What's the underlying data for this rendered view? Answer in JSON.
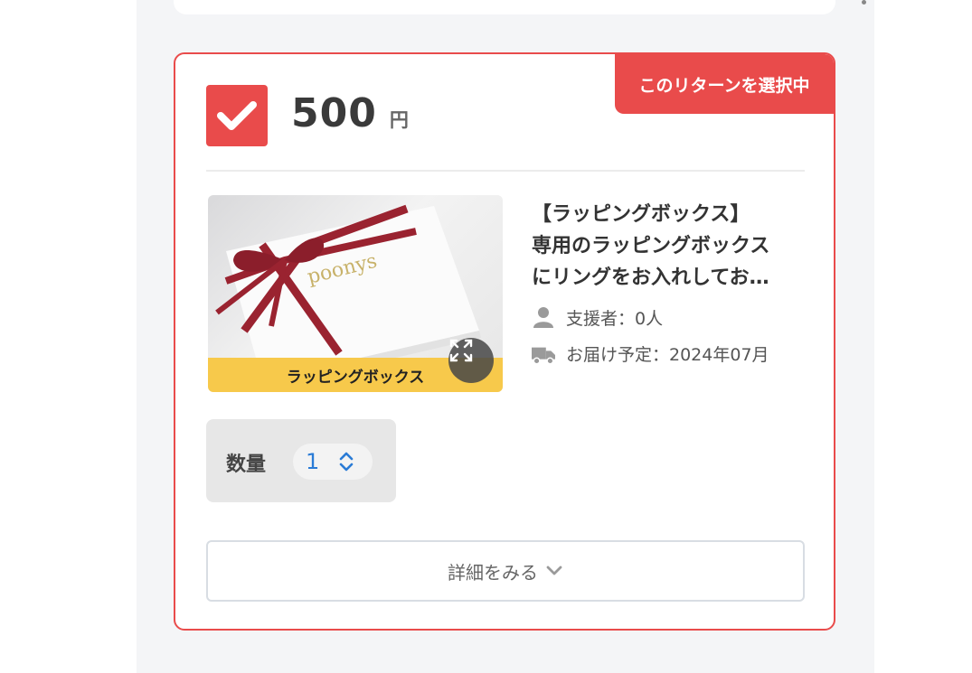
{
  "reward": {
    "selected_badge": "このリターンを選択中",
    "price": "500",
    "currency": "円",
    "image_label": "ラッピングボックス",
    "image_brand_text": "poonys",
    "title_lines": [
      "【ラッピングボックス】",
      "専用のラッピングボックス",
      "にリングをお入れしてお…"
    ],
    "supporters": "支援者：0人",
    "delivery": "お届け予定：2024年07月",
    "quantity_label": "数量",
    "quantity_value": "1",
    "details_button": "詳細をみる"
  },
  "icons": {
    "checkbox": "check-icon",
    "expand": "expand-icon",
    "supporters": "person-icon",
    "delivery": "truck-icon",
    "stepper": "up-down-chevron-icon",
    "details": "chevron-down-icon"
  },
  "colors": {
    "accent": "#e94b4b",
    "label_bar": "#f7c94b",
    "quantity_value": "#2a7bd6",
    "ribbon": "#9a2330"
  }
}
